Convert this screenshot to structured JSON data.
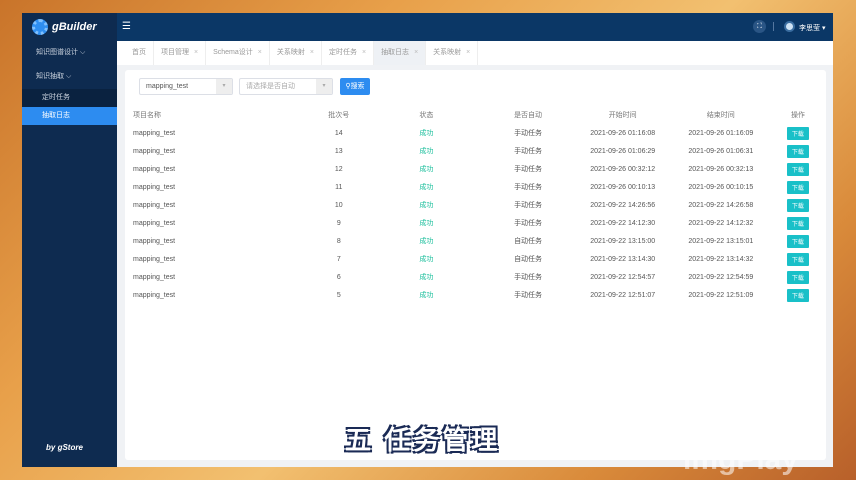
{
  "app": {
    "title": "gBuilder",
    "powered_by": "gStore",
    "user": "李思莹"
  },
  "sidebar": {
    "items": [
      {
        "label": "知识图谱设计 ⌵"
      },
      {
        "label": "知识抽取 ⌵"
      }
    ],
    "sub_items": [
      {
        "label": "定时任务"
      },
      {
        "label": "抽取日志"
      }
    ]
  },
  "tabs": [
    {
      "label": "首页"
    },
    {
      "label": "项目管理"
    },
    {
      "label": "Schema设计"
    },
    {
      "label": "关系映射"
    },
    {
      "label": "定时任务"
    },
    {
      "label": "抽取日志"
    },
    {
      "label": "关系映射"
    }
  ],
  "filters": {
    "project": "mapping_test",
    "auto_placeholder": "请选择是否自动",
    "search_label": "搜索"
  },
  "table": {
    "headers": [
      "项目名称",
      "批次号",
      "状态",
      "是否自动",
      "开始时间",
      "结束时间",
      "操作"
    ],
    "rows": [
      [
        "mapping_test",
        "14",
        "成功",
        "手动任务",
        "2021-09-26 01:16:08",
        "2021-09-26 01:16:09",
        "下载"
      ],
      [
        "mapping_test",
        "13",
        "成功",
        "手动任务",
        "2021-09-26 01:06:29",
        "2021-09-26 01:06:31",
        "下载"
      ],
      [
        "mapping_test",
        "12",
        "成功",
        "手动任务",
        "2021-09-26 00:32:12",
        "2021-09-26 00:32:13",
        "下载"
      ],
      [
        "mapping_test",
        "11",
        "成功",
        "手动任务",
        "2021-09-26 00:10:13",
        "2021-09-26 00:10:15",
        "下载"
      ],
      [
        "mapping_test",
        "10",
        "成功",
        "手动任务",
        "2021-09-22 14:26:56",
        "2021-09-22 14:26:58",
        "下载"
      ],
      [
        "mapping_test",
        "9",
        "成功",
        "手动任务",
        "2021-09-22 14:12:30",
        "2021-09-22 14:12:32",
        "下载"
      ],
      [
        "mapping_test",
        "8",
        "成功",
        "自动任务",
        "2021-09-22 13:15:00",
        "2021-09-22 13:15:01",
        "下载"
      ],
      [
        "mapping_test",
        "7",
        "成功",
        "自动任务",
        "2021-09-22 13:14:30",
        "2021-09-22 13:14:32",
        "下载"
      ],
      [
        "mapping_test",
        "6",
        "成功",
        "手动任务",
        "2021-09-22 12:54:57",
        "2021-09-22 12:54:59",
        "下载"
      ],
      [
        "mapping_test",
        "5",
        "成功",
        "手动任务",
        "2021-09-22 12:51:07",
        "2021-09-22 12:51:09",
        "下载"
      ]
    ]
  },
  "overlay": {
    "subtitle": "五  任务管理",
    "watermark": "PikuPoo imgPlay"
  }
}
